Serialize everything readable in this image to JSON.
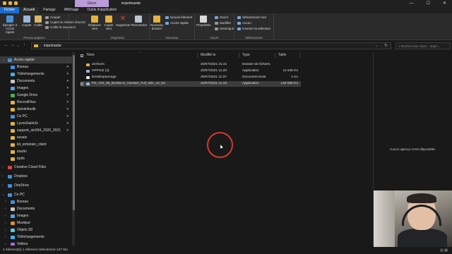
{
  "window": {
    "title": "imprimante",
    "context_tab": "Gérer",
    "controls": [
      "—",
      "☐",
      "✕"
    ]
  },
  "ribbon_tabs": [
    {
      "label": "Fichier"
    },
    {
      "label": "Accueil"
    },
    {
      "label": "Partage"
    },
    {
      "label": "Affichage"
    },
    {
      "label": "Outils d'application"
    }
  ],
  "ribbon": {
    "groups": {
      "clipboard": "Presse-papiers",
      "organize": "Organiser",
      "new": "Nouveau",
      "open": "Ouvrir",
      "select": "Sélectionner"
    },
    "pin_label": "Épingler à Accès rapide",
    "copy_label": "Copier",
    "paste_label": "Coller",
    "cut_label": "Couper",
    "copy_path_label": "Copier le chemin d'accès",
    "paste_shortcut_label": "Coller le raccourci",
    "move_to_label": "Déplacer vers",
    "copy_to_label": "Copier vers",
    "delete_label": "Supprimer",
    "rename_label": "Renommer",
    "new_folder_label": "Nouveau dossier",
    "new_item_label": "Nouvel élément",
    "easy_access_label": "Accès rapide",
    "properties_label": "Propriétés",
    "open_label": "Ouvrir",
    "edit_label": "Modifier",
    "history_label": "Historique",
    "select_all_label": "Sélectionner tout",
    "select_none_label": "Aucun",
    "invert_selection_label": "Inverser la sélection"
  },
  "address": {
    "path": "imprimante",
    "search_placeholder": "Rechercher dans : impri..."
  },
  "nav": {
    "quick_access": "Accès rapide",
    "items": [
      {
        "label": "Bureau",
        "pinned": true
      },
      {
        "label": "Téléchargements",
        "pinned": true
      },
      {
        "label": "Documents",
        "pinned": true
      },
      {
        "label": "Images",
        "pinned": true
      },
      {
        "label": "Google Drive",
        "pinned": true
      },
      {
        "label": "RecordFiles",
        "pinned": true
      },
      {
        "label": "domiinfocdk",
        "pinned": true
      },
      {
        "label": "Ce PC",
        "pinned": true
      },
      {
        "label": "LyceeSaintJo",
        "pinned": true
      },
      {
        "label": "support_stc504_2020_2021",
        "pinned": true
      },
      {
        "label": "essais",
        "pinned": false
      },
      {
        "label": "kit_entretien_client",
        "pinned": false
      },
      {
        "label": "martin",
        "pinned": false
      },
      {
        "label": "tarifs",
        "pinned": false
      }
    ],
    "roots": [
      {
        "label": "Creative Cloud Files"
      },
      {
        "label": "Dropbox"
      },
      {
        "label": "OneDrive"
      },
      {
        "label": "Ce PC"
      }
    ],
    "this_pc": [
      {
        "label": "Bureau"
      },
      {
        "label": "Documents"
      },
      {
        "label": "Images"
      },
      {
        "label": "Musique"
      },
      {
        "label": "Objets 3D"
      },
      {
        "label": "Téléchargements"
      },
      {
        "label": "Vidéos"
      }
    ]
  },
  "columns": {
    "name": "Nom",
    "modified": "Modifié le",
    "type": "Type",
    "size": "Taille"
  },
  "files": [
    {
      "name": "archives",
      "modified": "20/07/2021 21:21",
      "type": "Dossier de fichiers",
      "size": "",
      "icon": "folder",
      "selected": false
    },
    {
      "name": "HPPSdr (4)",
      "modified": "20/07/2021 11:20",
      "type": "Application",
      "size": "11 535 Ko",
      "icon": "app",
      "selected": false
    },
    {
      "name": "liensDepannage",
      "modified": "20/07/2021 11:37",
      "type": "Document texte",
      "size": "1 Ko",
      "icon": "text",
      "selected": false
    },
    {
      "name": "PS_AIO_06_B109a-m_NonNet_Full_Win_10_64",
      "modified": "20/07/2021 11:19",
      "type": "Application",
      "size": "140 566 Ko",
      "icon": "app",
      "selected": true
    }
  ],
  "preview": {
    "message": "Aucun aperçu n'est disponible."
  },
  "status": {
    "text": "4 élément(s)    1 élément sélectionné  137 Mo"
  },
  "colors": {
    "accent": "#1c6dd0",
    "folder": "#e2b245",
    "context_tab": "#b99cd8",
    "cursor_ring": "#d23b2e"
  }
}
